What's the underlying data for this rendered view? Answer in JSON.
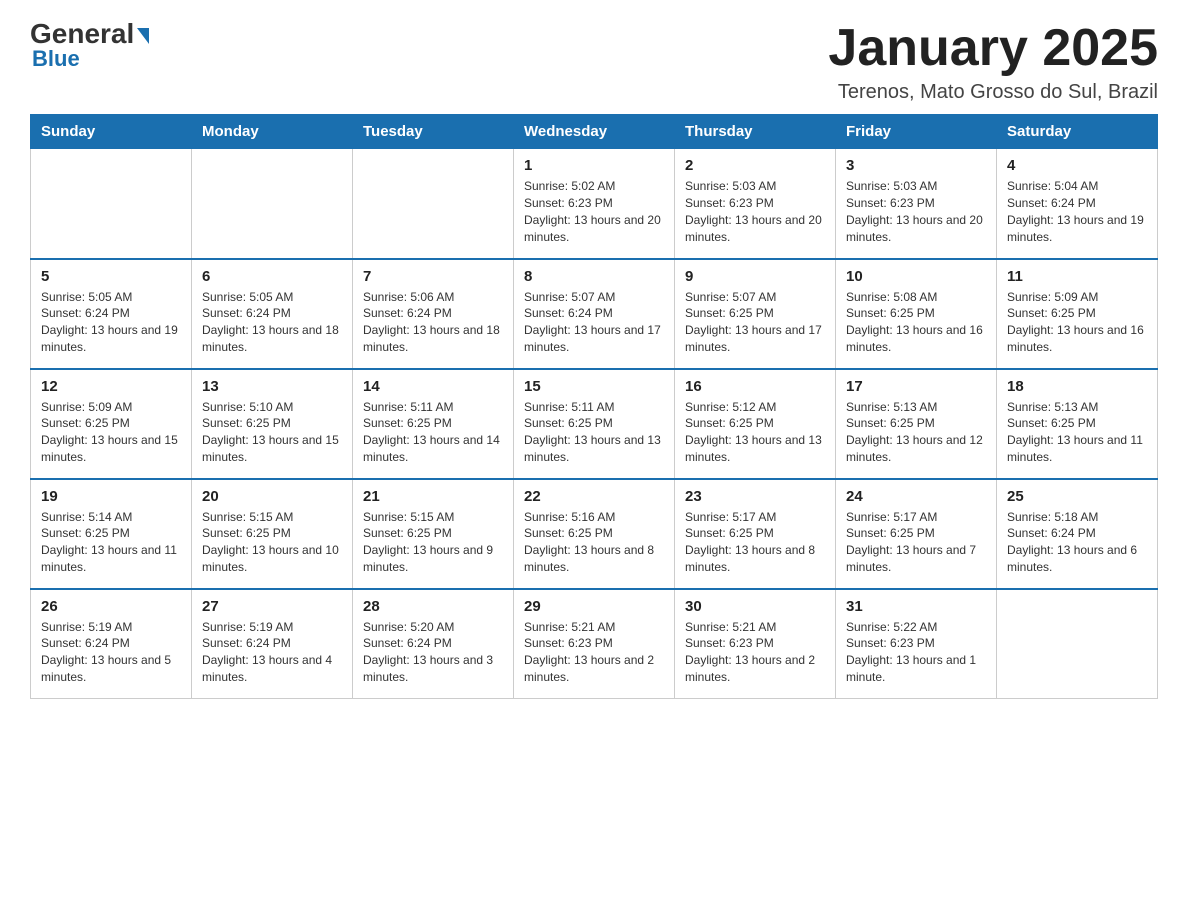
{
  "header": {
    "logo_main": "General",
    "logo_sub": "Blue",
    "month_title": "January 2025",
    "location": "Terenos, Mato Grosso do Sul, Brazil"
  },
  "days_of_week": [
    "Sunday",
    "Monday",
    "Tuesday",
    "Wednesday",
    "Thursday",
    "Friday",
    "Saturday"
  ],
  "weeks": [
    [
      {
        "day": "",
        "info": ""
      },
      {
        "day": "",
        "info": ""
      },
      {
        "day": "",
        "info": ""
      },
      {
        "day": "1",
        "info": "Sunrise: 5:02 AM\nSunset: 6:23 PM\nDaylight: 13 hours and 20 minutes."
      },
      {
        "day": "2",
        "info": "Sunrise: 5:03 AM\nSunset: 6:23 PM\nDaylight: 13 hours and 20 minutes."
      },
      {
        "day": "3",
        "info": "Sunrise: 5:03 AM\nSunset: 6:23 PM\nDaylight: 13 hours and 20 minutes."
      },
      {
        "day": "4",
        "info": "Sunrise: 5:04 AM\nSunset: 6:24 PM\nDaylight: 13 hours and 19 minutes."
      }
    ],
    [
      {
        "day": "5",
        "info": "Sunrise: 5:05 AM\nSunset: 6:24 PM\nDaylight: 13 hours and 19 minutes."
      },
      {
        "day": "6",
        "info": "Sunrise: 5:05 AM\nSunset: 6:24 PM\nDaylight: 13 hours and 18 minutes."
      },
      {
        "day": "7",
        "info": "Sunrise: 5:06 AM\nSunset: 6:24 PM\nDaylight: 13 hours and 18 minutes."
      },
      {
        "day": "8",
        "info": "Sunrise: 5:07 AM\nSunset: 6:24 PM\nDaylight: 13 hours and 17 minutes."
      },
      {
        "day": "9",
        "info": "Sunrise: 5:07 AM\nSunset: 6:25 PM\nDaylight: 13 hours and 17 minutes."
      },
      {
        "day": "10",
        "info": "Sunrise: 5:08 AM\nSunset: 6:25 PM\nDaylight: 13 hours and 16 minutes."
      },
      {
        "day": "11",
        "info": "Sunrise: 5:09 AM\nSunset: 6:25 PM\nDaylight: 13 hours and 16 minutes."
      }
    ],
    [
      {
        "day": "12",
        "info": "Sunrise: 5:09 AM\nSunset: 6:25 PM\nDaylight: 13 hours and 15 minutes."
      },
      {
        "day": "13",
        "info": "Sunrise: 5:10 AM\nSunset: 6:25 PM\nDaylight: 13 hours and 15 minutes."
      },
      {
        "day": "14",
        "info": "Sunrise: 5:11 AM\nSunset: 6:25 PM\nDaylight: 13 hours and 14 minutes."
      },
      {
        "day": "15",
        "info": "Sunrise: 5:11 AM\nSunset: 6:25 PM\nDaylight: 13 hours and 13 minutes."
      },
      {
        "day": "16",
        "info": "Sunrise: 5:12 AM\nSunset: 6:25 PM\nDaylight: 13 hours and 13 minutes."
      },
      {
        "day": "17",
        "info": "Sunrise: 5:13 AM\nSunset: 6:25 PM\nDaylight: 13 hours and 12 minutes."
      },
      {
        "day": "18",
        "info": "Sunrise: 5:13 AM\nSunset: 6:25 PM\nDaylight: 13 hours and 11 minutes."
      }
    ],
    [
      {
        "day": "19",
        "info": "Sunrise: 5:14 AM\nSunset: 6:25 PM\nDaylight: 13 hours and 11 minutes."
      },
      {
        "day": "20",
        "info": "Sunrise: 5:15 AM\nSunset: 6:25 PM\nDaylight: 13 hours and 10 minutes."
      },
      {
        "day": "21",
        "info": "Sunrise: 5:15 AM\nSunset: 6:25 PM\nDaylight: 13 hours and 9 minutes."
      },
      {
        "day": "22",
        "info": "Sunrise: 5:16 AM\nSunset: 6:25 PM\nDaylight: 13 hours and 8 minutes."
      },
      {
        "day": "23",
        "info": "Sunrise: 5:17 AM\nSunset: 6:25 PM\nDaylight: 13 hours and 8 minutes."
      },
      {
        "day": "24",
        "info": "Sunrise: 5:17 AM\nSunset: 6:25 PM\nDaylight: 13 hours and 7 minutes."
      },
      {
        "day": "25",
        "info": "Sunrise: 5:18 AM\nSunset: 6:24 PM\nDaylight: 13 hours and 6 minutes."
      }
    ],
    [
      {
        "day": "26",
        "info": "Sunrise: 5:19 AM\nSunset: 6:24 PM\nDaylight: 13 hours and 5 minutes."
      },
      {
        "day": "27",
        "info": "Sunrise: 5:19 AM\nSunset: 6:24 PM\nDaylight: 13 hours and 4 minutes."
      },
      {
        "day": "28",
        "info": "Sunrise: 5:20 AM\nSunset: 6:24 PM\nDaylight: 13 hours and 3 minutes."
      },
      {
        "day": "29",
        "info": "Sunrise: 5:21 AM\nSunset: 6:23 PM\nDaylight: 13 hours and 2 minutes."
      },
      {
        "day": "30",
        "info": "Sunrise: 5:21 AM\nSunset: 6:23 PM\nDaylight: 13 hours and 2 minutes."
      },
      {
        "day": "31",
        "info": "Sunrise: 5:22 AM\nSunset: 6:23 PM\nDaylight: 13 hours and 1 minute."
      },
      {
        "day": "",
        "info": ""
      }
    ]
  ]
}
